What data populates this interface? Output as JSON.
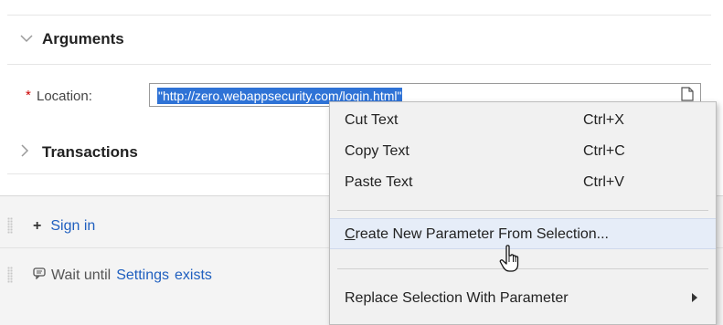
{
  "arguments": {
    "title": "Arguments",
    "location_label": "Location:",
    "required_marker": "*",
    "location_value": "\"http://zero.webappsecurity.com/login.html\""
  },
  "transactions": {
    "title": "Transactions"
  },
  "steps": [
    {
      "prefix": "+",
      "label": "Sign in"
    },
    {
      "prefix": "Wait until",
      "target": "Settings",
      "condition": "exists"
    }
  ],
  "context_menu": {
    "items": [
      {
        "label": "Cut Text",
        "shortcut": "Ctrl+X"
      },
      {
        "label": "Copy Text",
        "shortcut": "Ctrl+C"
      },
      {
        "label": "Paste Text",
        "shortcut": "Ctrl+V"
      },
      {
        "label_underlined": "C",
        "label_rest": "reate New Parameter From Selection..."
      },
      {
        "label": "Replace Selection With Parameter"
      }
    ]
  },
  "icons": [
    "chevron-down-icon",
    "chevron-right-icon",
    "document-icon",
    "grip-icon",
    "plus-icon",
    "comment-icon",
    "submenu-arrow-icon",
    "hand-cursor-icon"
  ]
}
